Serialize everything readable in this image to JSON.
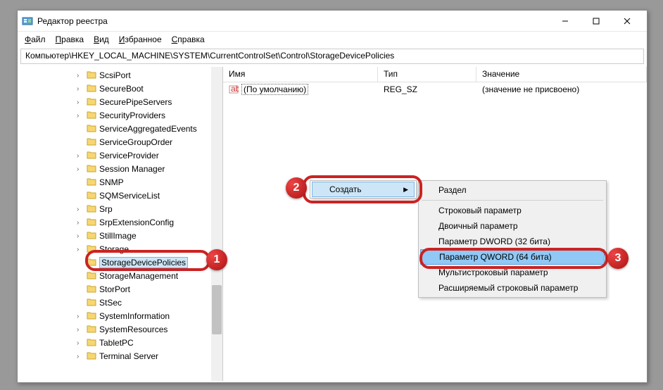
{
  "window": {
    "title": "Редактор реестра"
  },
  "menus": {
    "file": "Файл",
    "edit": "Правка",
    "view": "Вид",
    "favorites": "Избранное",
    "help": "Справка"
  },
  "address": "Компьютер\\HKEY_LOCAL_MACHINE\\SYSTEM\\CurrentControlSet\\Control\\StorageDevicePolicies",
  "tree": [
    "ScsiPort",
    "SecureBoot",
    "SecurePipeServers",
    "SecurityProviders",
    "ServiceAggregatedEvents",
    "ServiceGroupOrder",
    "ServiceProvider",
    "Session Manager",
    "SNMP",
    "SQMServiceList",
    "Srp",
    "SrpExtensionConfig",
    "StillImage",
    "Storage",
    "StorageDevicePolicies",
    "StorageManagement",
    "StorPort",
    "StSec",
    "SystemInformation",
    "SystemResources",
    "TabletPC",
    "Terminal Server"
  ],
  "list": {
    "cols": {
      "name": "Имя",
      "type": "Тип",
      "value": "Значение"
    },
    "row": {
      "name": "(По умолчанию)",
      "type": "REG_SZ",
      "value": "(значение не присвоено)"
    }
  },
  "context": {
    "create": "Создать"
  },
  "submenu": {
    "section": "Раздел",
    "string": "Строковый параметр",
    "binary": "Двоичный параметр",
    "dword": "Параметр DWORD (32 бита)",
    "qword": "Параметр QWORD (64 бита)",
    "multi": "Мультистроковый параметр",
    "expand": "Расширяемый строковый параметр"
  },
  "badges": {
    "b1": "1",
    "b2": "2",
    "b3": "3"
  }
}
